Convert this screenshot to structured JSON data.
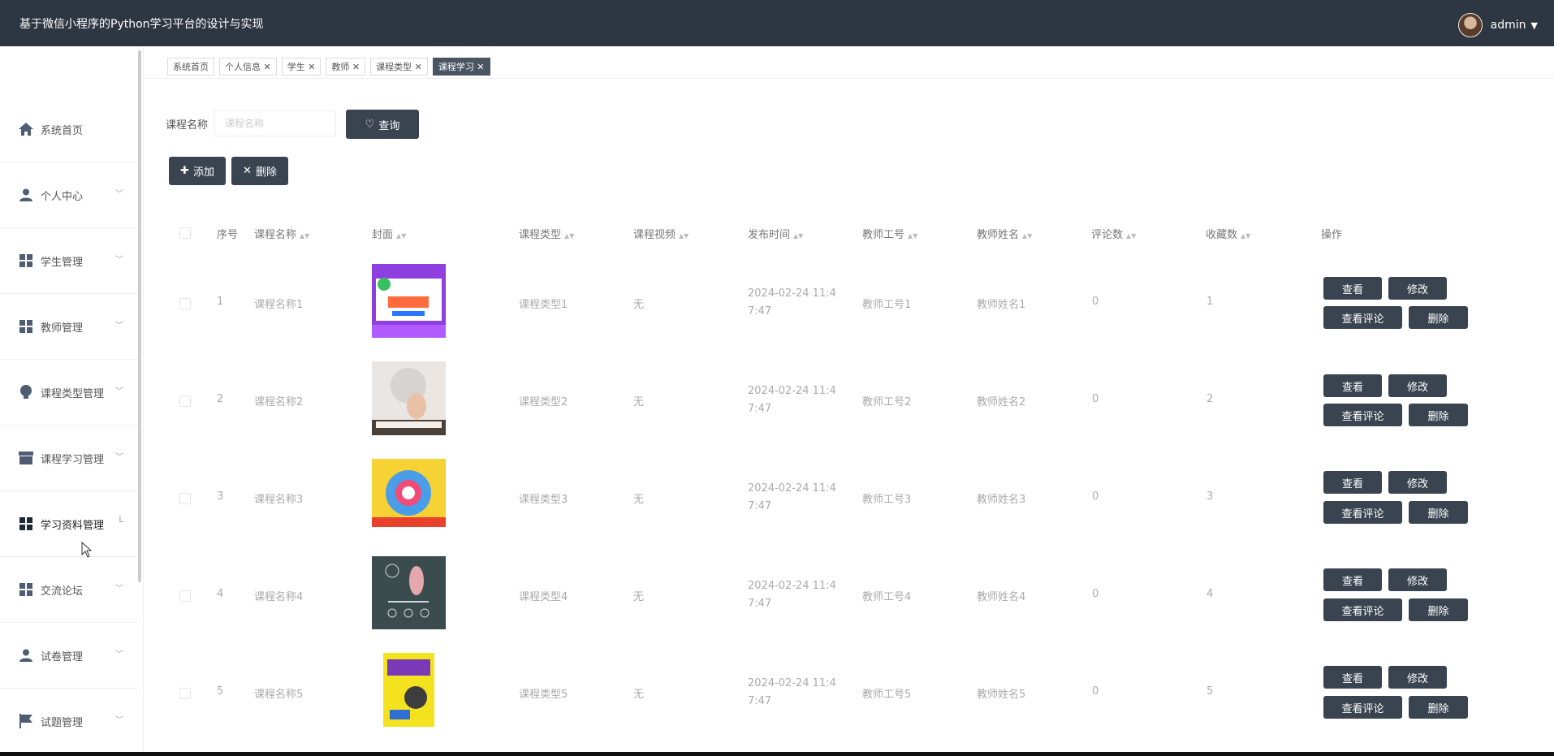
{
  "app": {
    "title": "基于微信小程序的Python学习平台的设计与实现",
    "user": "admin"
  },
  "sidebar": {
    "items": [
      {
        "label": "系统首页",
        "icon": "home-icon"
      },
      {
        "label": "个人中心",
        "icon": "user-icon"
      },
      {
        "label": "学生管理",
        "icon": "grid-icon"
      },
      {
        "label": "教师管理",
        "icon": "grid-icon"
      },
      {
        "label": "课程类型管理",
        "icon": "bulb-icon"
      },
      {
        "label": "课程学习管理",
        "icon": "store-icon"
      },
      {
        "label": "学习资料管理",
        "icon": "grid-icon"
      },
      {
        "label": "交流论坛",
        "icon": "grid-icon"
      },
      {
        "label": "试卷管理",
        "icon": "user-icon"
      },
      {
        "label": "试题管理",
        "icon": "flag-icon"
      }
    ]
  },
  "tabs": [
    {
      "label": "系统首页"
    },
    {
      "label": "个人信息 ✕"
    },
    {
      "label": "学生 ✕"
    },
    {
      "label": "教师 ✕"
    },
    {
      "label": "课程类型 ✕"
    },
    {
      "label": "课程学习 ✕",
      "active": true
    }
  ],
  "search": {
    "label": "课程名称",
    "placeholder": "课程名称",
    "button": "查询"
  },
  "actions": {
    "add": "添加",
    "delete": "删除"
  },
  "table": {
    "headers": [
      "序号",
      "课程名称",
      "封面",
      "课程类型",
      "课程视频",
      "发布时间",
      "教师工号",
      "教师姓名",
      "评论数",
      "收藏数",
      "操作"
    ],
    "rows": [
      {
        "index": "1",
        "name": "课程名称1",
        "type": "课程类型1",
        "video": "无",
        "time": "2024-02-24 11:47:47",
        "teacher_no": "教师工号1",
        "teacher_name": "教师姓名1",
        "comments": "0",
        "favorites": "1"
      },
      {
        "index": "2",
        "name": "课程名称2",
        "type": "课程类型2",
        "video": "无",
        "time": "2024-02-24 11:47:47",
        "teacher_no": "教师工号2",
        "teacher_name": "教师姓名2",
        "comments": "0",
        "favorites": "2"
      },
      {
        "index": "3",
        "name": "课程名称3",
        "type": "课程类型3",
        "video": "无",
        "time": "2024-02-24 11:47:47",
        "teacher_no": "教师工号3",
        "teacher_name": "教师姓名3",
        "comments": "0",
        "favorites": "3"
      },
      {
        "index": "4",
        "name": "课程名称4",
        "type": "课程类型4",
        "video": "无",
        "time": "2024-02-24 11:47:47",
        "teacher_no": "教师工号4",
        "teacher_name": "教师姓名4",
        "comments": "0",
        "favorites": "4"
      },
      {
        "index": "5",
        "name": "课程名称5",
        "type": "课程类型5",
        "video": "无",
        "time": "2024-02-24 11:47:47",
        "teacher_no": "教师工号5",
        "teacher_name": "教师姓名5",
        "comments": "0",
        "favorites": "5"
      }
    ],
    "row_actions": {
      "view": "查看",
      "edit": "修改",
      "comments": "查看评论",
      "delete": "删除"
    }
  },
  "colors": {
    "header_bg": "#2e3642",
    "button_bg": "#3a4450",
    "active_tab": "#4a5564"
  }
}
